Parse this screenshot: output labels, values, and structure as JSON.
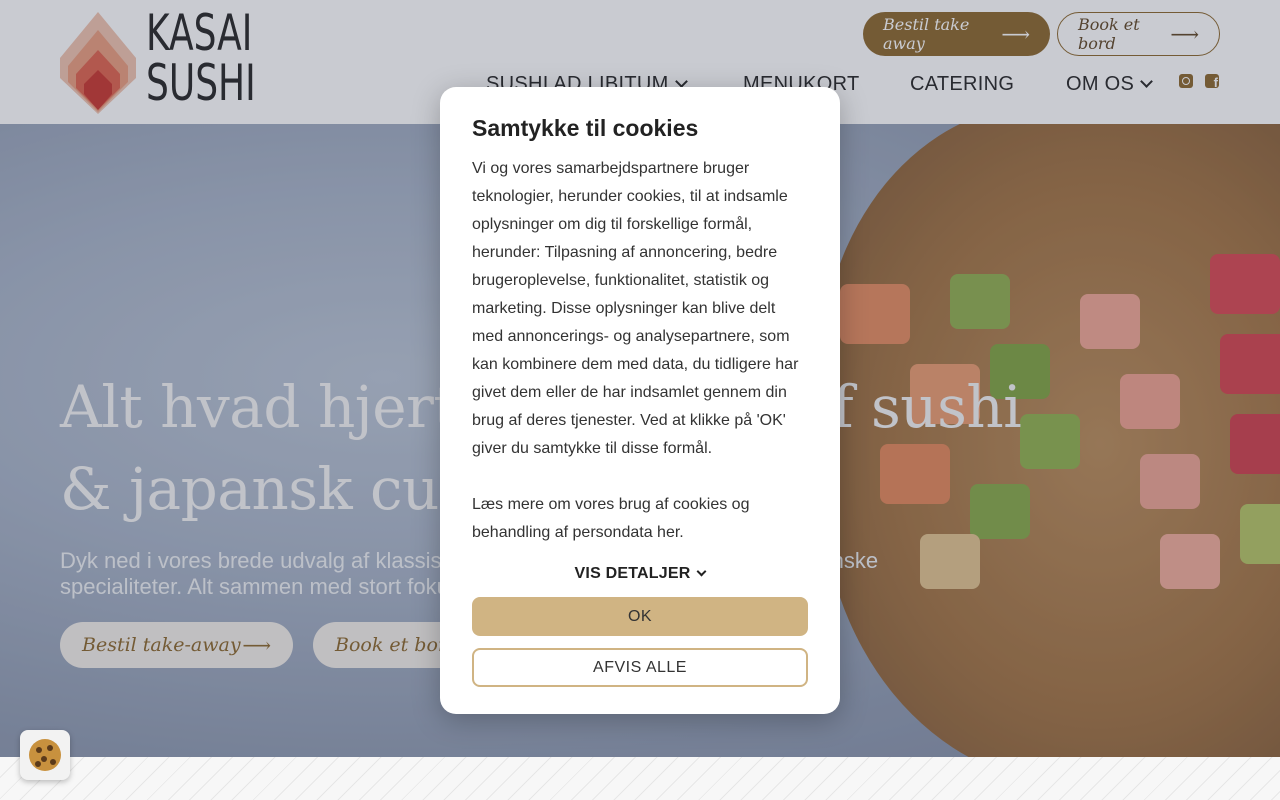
{
  "brand": {
    "line1": "KASAI",
    "line2": "SUSHI"
  },
  "header": {
    "takeaway_label": "Bestil take away",
    "book_label": "Book et bord",
    "nav": [
      "SUSHI AD LIBITUM",
      "MENUKORT",
      "CATERING",
      "OM OS"
    ]
  },
  "social": {
    "instagram": "instagram-icon",
    "facebook": "facebook-icon"
  },
  "hero": {
    "title_line1": "Alt hvad hjertet begærer af sushi",
    "title_line2": "& japansk cuisine",
    "subtitle": "Dyk ned i vores brede udvalg af klassisk og nytænkende sushi samt andre japanske specialiteter. Alt sammen med stort fokus på god kvalitet og venlig service.",
    "btn_takeaway": "Bestil take-away",
    "btn_book": "Book et bord"
  },
  "cookie_dialog": {
    "title": "Samtykke til cookies",
    "body": "Vi og vores samarbejdspartnere bruger teknologier, herunder cookies, til at indsamle oplysninger om dig til forskellige formål, herunder: Tilpasning af annoncering, bedre brugeroplevelse, funktionalitet, statistik og marketing. Disse oplysninger kan blive delt med annoncerings- og analysepartnere, som kan kombinere dem med data, du tidligere har givet dem eller de har indsamlet gennem din brug af deres tjenester. Ved at klikke på 'OK' giver du samtykke til disse formål.",
    "more": "Læs mere om vores brug af cookies og behandling af persondata her.",
    "details_label": "VIS DETALJER",
    "ok_label": "OK",
    "reject_label": "AFVIS ALLE"
  },
  "colors": {
    "brand": "#8a6428",
    "accent": "#d0b483"
  }
}
